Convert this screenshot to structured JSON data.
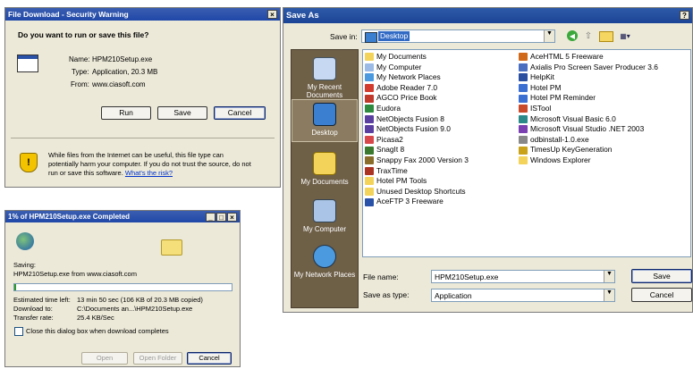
{
  "security": {
    "title": "File Download - Security Warning",
    "close": "×",
    "question": "Do you want to run or save this file?",
    "name_label": "Name:",
    "name_value": "HPM210Setup.exe",
    "type_label": "Type:",
    "type_value": "Application, 20.3 MB",
    "from_label": "From:",
    "from_value": "www.ciasoft.com",
    "run": "Run",
    "save": "Save",
    "cancel": "Cancel",
    "warning_1": "While files from the Internet can be useful, this file type can",
    "warning_2": "potentially harm your computer. If you do not trust the source, do not",
    "warning_3": "run or save this software.",
    "risk_link": "What's the risk?"
  },
  "progress": {
    "title": "1% of HPM210Setup.exe Completed",
    "saving_label": "Saving:",
    "saving_value": "HPM210Setup.exe from www.ciasoft.com",
    "percent": 1,
    "est_label": "Estimated time left:",
    "est_value": "13 min 50 sec (106 KB of 20.3 MB copied)",
    "dl_label": "Download to:",
    "dl_value": "C:\\Documents an...\\HPM210Setup.exe",
    "rate_label": "Transfer rate:",
    "rate_value": "25.4 KB/Sec",
    "close_check": "Close this dialog box when download completes",
    "open": "Open",
    "open_folder": "Open Folder",
    "cancel": "Cancel"
  },
  "saveas": {
    "title": "Save As",
    "help": "?",
    "close": "×",
    "save_in_label": "Save in:",
    "save_in_value": "Desktop",
    "places": [
      "My Recent Documents",
      "Desktop",
      "My Documents",
      "My Computer",
      "My Network Places"
    ],
    "files_col1": [
      "My Documents",
      "My Computer",
      "My Network Places",
      "Adobe Reader 7.0",
      "AGCO Price Book",
      "Eudora",
      "NetObjects Fusion 8",
      "NetObjects Fusion 9.0",
      "Picasa2",
      "SnagIt 8",
      "Snappy Fax 2000 Version 3",
      "TraxTime",
      "Hotel PM Tools",
      "Unused Desktop Shortcuts",
      "AceFTP 3 Freeware"
    ],
    "files_col2": [
      "AceHTML 5 Freeware",
      "Axialis Pro Screen Saver Producer 3.6",
      "HelpKit",
      "Hotel PM",
      "Hotel PM Reminder",
      "ISTool",
      "Microsoft Visual Basic 6.0",
      "Microsoft Visual Studio .NET 2003",
      "odbinstall-1.0.exe",
      "TimesUp KeyGeneration",
      "Windows Explorer"
    ],
    "file_name_label": "File name:",
    "file_name_value": "HPM210Setup.exe",
    "save_type_label": "Save as type:",
    "save_type_value": "Application",
    "save": "Save",
    "cancel": "Cancel"
  },
  "colors": {
    "title_blue": "#2a51a8",
    "places_brown": "#6e5f47",
    "dialog_bg": "#ece9d8"
  }
}
